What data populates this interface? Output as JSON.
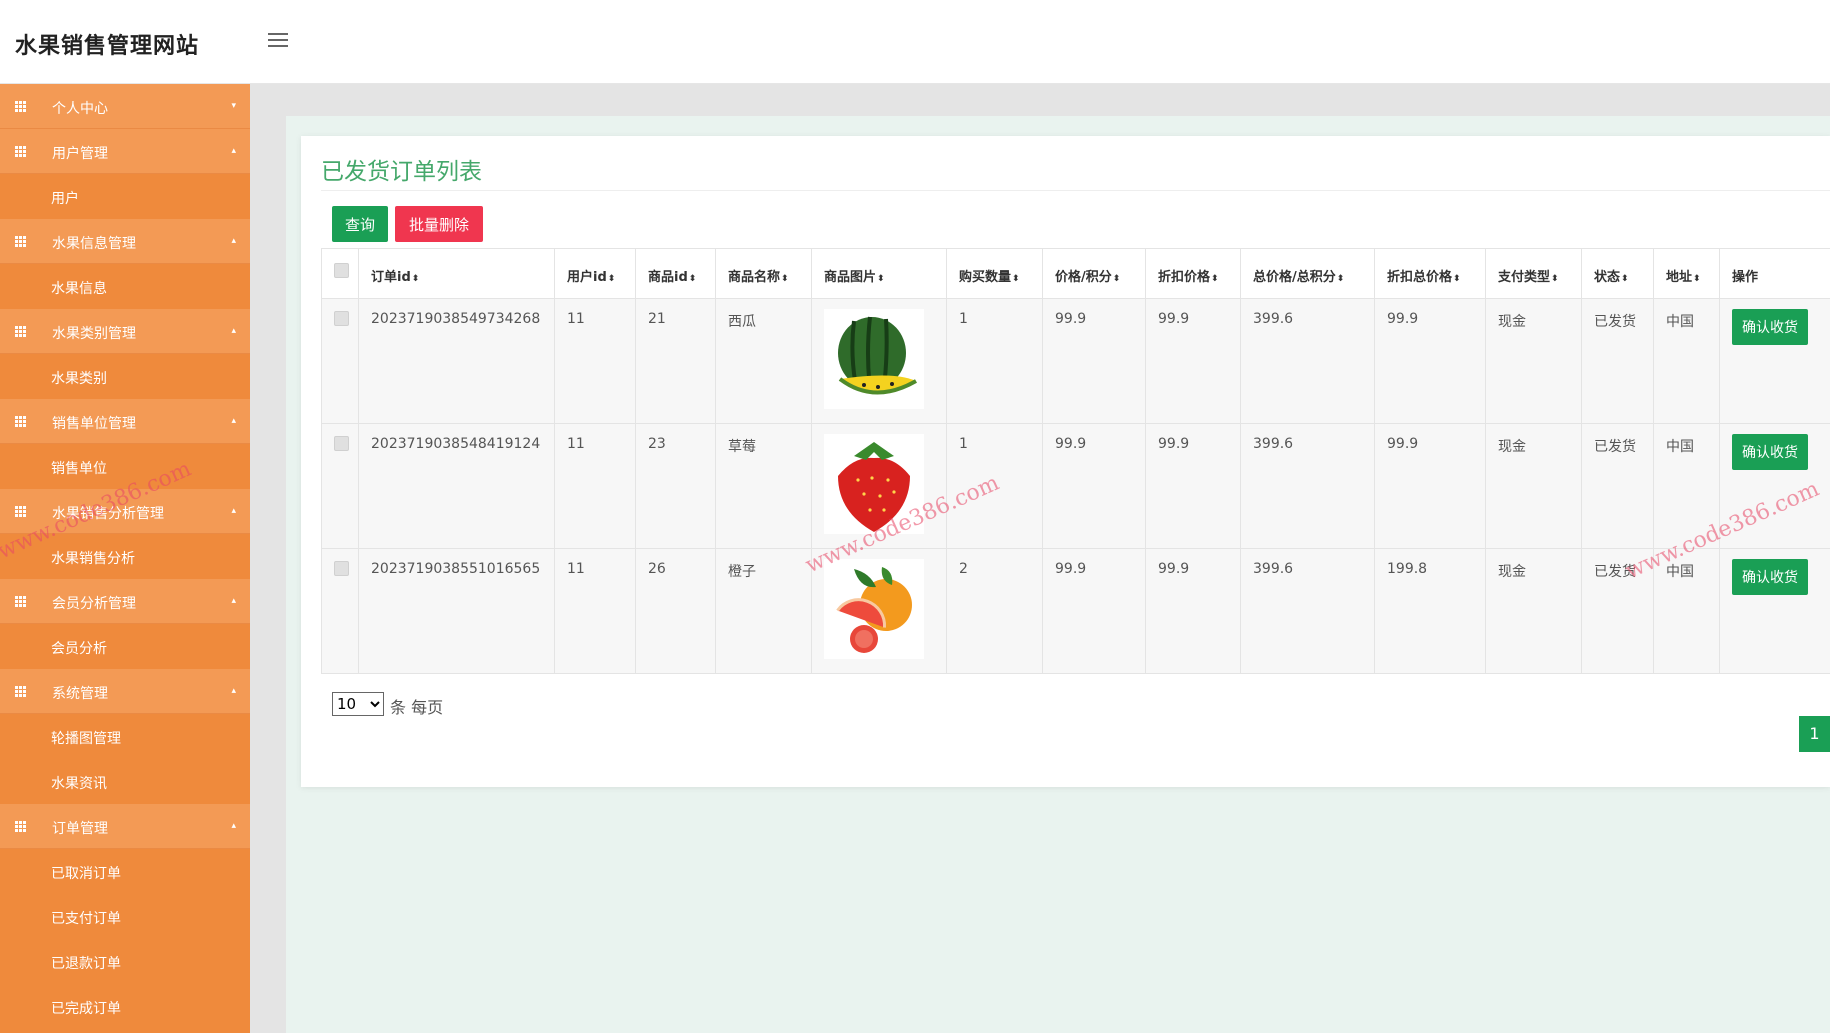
{
  "header": {
    "title": "水果销售管理网站",
    "menu_icon": "hamburger-icon"
  },
  "sidebar": {
    "groups": [
      {
        "label": "个人中心",
        "icon": "grid-icon",
        "items": []
      },
      {
        "label": "用户管理",
        "icon": "grid-icon",
        "items": [
          "用户"
        ]
      },
      {
        "label": "水果信息管理",
        "icon": "grid-icon",
        "items": [
          "水果信息"
        ]
      },
      {
        "label": "水果类别管理",
        "icon": "grid-icon",
        "items": [
          "水果类别"
        ]
      },
      {
        "label": "销售单位管理",
        "icon": "grid-icon",
        "items": [
          "销售单位"
        ]
      },
      {
        "label": "水果销售分析管理",
        "icon": "grid-icon",
        "items": [
          "水果销售分析"
        ]
      },
      {
        "label": "会员分析管理",
        "icon": "grid-icon",
        "items": [
          "会员分析"
        ]
      },
      {
        "label": "系统管理",
        "icon": "grid-icon",
        "items": [
          "轮播图管理",
          "水果资讯"
        ]
      },
      {
        "label": "订单管理",
        "icon": "grid-icon",
        "items": [
          "已取消订单",
          "已支付订单",
          "已退款订单",
          "已完成订单"
        ]
      }
    ]
  },
  "main": {
    "title": "已发货订单列表",
    "buttons": {
      "query": "查询",
      "batch_delete": "批量删除"
    },
    "table": {
      "columns": [
        "订单id",
        "用户id",
        "商品id",
        "商品名称",
        "商品图片",
        "购买数量",
        "价格/积分",
        "折扣价格",
        "总价格/总积分",
        "折扣总价格",
        "支付类型",
        "状态",
        "地址",
        "操作"
      ],
      "sortable": [
        true,
        true,
        true,
        true,
        true,
        true,
        true,
        true,
        true,
        true,
        true,
        true,
        true,
        false
      ],
      "rows": [
        {
          "order_id": "2023719038549734268",
          "user_id": "11",
          "product_id": "21",
          "name": "西瓜",
          "image": "watermelon",
          "qty": "1",
          "price": "99.9",
          "discount_price": "99.9",
          "total": "399.6",
          "discount_total": "99.9",
          "pay_type": "现金",
          "status": "已发货",
          "address": "中国",
          "action": "确认收货"
        },
        {
          "order_id": "2023719038548419124",
          "user_id": "11",
          "product_id": "23",
          "name": "草莓",
          "image": "strawberry",
          "qty": "1",
          "price": "99.9",
          "discount_price": "99.9",
          "total": "399.6",
          "discount_total": "99.9",
          "pay_type": "现金",
          "status": "已发货",
          "address": "中国",
          "action": "确认收货"
        },
        {
          "order_id": "2023719038551016565",
          "user_id": "11",
          "product_id": "26",
          "name": "橙子",
          "image": "orange",
          "qty": "2",
          "price": "99.9",
          "discount_price": "99.9",
          "total": "399.6",
          "discount_total": "199.8",
          "pay_type": "现金",
          "status": "已发货",
          "address": "中国",
          "action": "确认收货"
        }
      ]
    },
    "pagination": {
      "page_size": "10",
      "page_size_options": [
        "10"
      ],
      "per_page_label": "条 每页",
      "current_page": "1"
    }
  },
  "watermark": "www.code386.com",
  "colors": {
    "sidebar": "#ef8a3c",
    "sidebar_group": "#f39a55",
    "accent_green": "#1a9f55",
    "danger": "#f0364f",
    "title_green": "#45a86b"
  }
}
